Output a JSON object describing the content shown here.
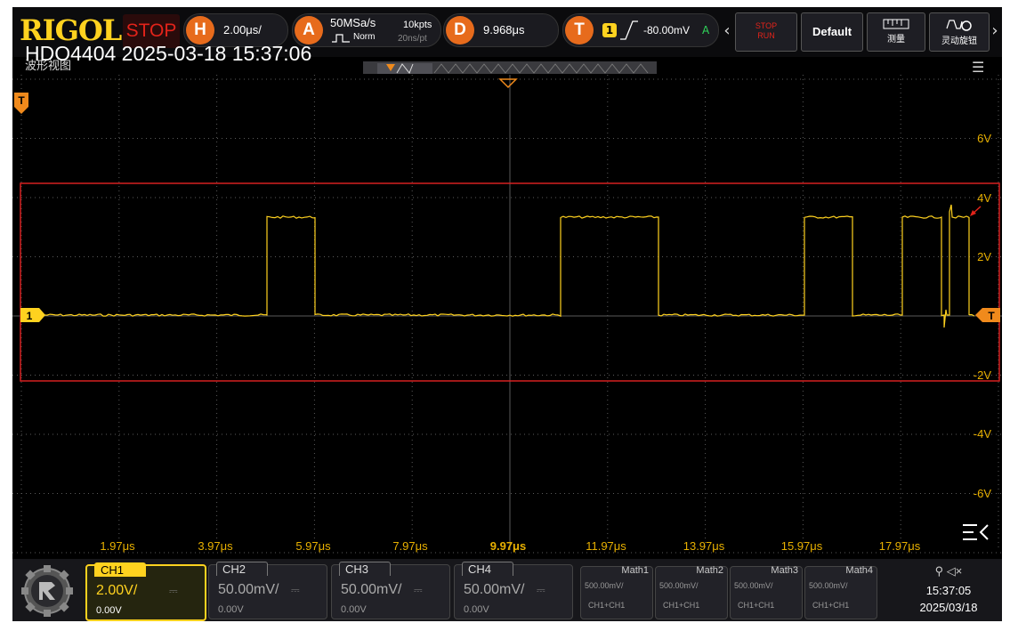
{
  "topbar": {
    "brand": "RIGOL",
    "run_state": "STOP",
    "horizontal": {
      "badge": "H",
      "scale": "2.00μs/"
    },
    "acquire": {
      "badge": "A",
      "sample_rate": "50MSa/s",
      "mode": "Norm",
      "memory": "10kpts",
      "interval": "20ns/pt"
    },
    "delay": {
      "badge": "D",
      "value": "9.968μs"
    },
    "trigger": {
      "badge": "T",
      "channel": "1",
      "level": "-80.00mV",
      "sweep": "A"
    },
    "buttons": {
      "stop_run_1": "STOP",
      "stop_run_2": "RUN",
      "default": "Default",
      "measure": "测量",
      "knob": "灵动旋钮"
    }
  },
  "title": {
    "device": "HDO4404 2025-03-18 15:37:06",
    "view": "波形视图"
  },
  "grid": {
    "channel_marker": "1",
    "trigger_marker": "T",
    "time_labels": [
      "1.97μs",
      "3.97μs",
      "5.97μs",
      "7.97μs",
      "9.97μs",
      "11.97μs",
      "13.97μs",
      "15.97μs",
      "17.97μs"
    ],
    "volt_labels": [
      "6V",
      "4V",
      "2V",
      "-2V",
      "-4V",
      "-6V"
    ]
  },
  "channels": [
    {
      "name": "CH1",
      "scale": "2.00V/",
      "offset": "0.00V",
      "active": true
    },
    {
      "name": "CH2",
      "scale": "50.00mV/",
      "offset": "0.00V",
      "active": false
    },
    {
      "name": "CH3",
      "scale": "50.00mV/",
      "offset": "0.00V",
      "active": false
    },
    {
      "name": "CH4",
      "scale": "50.00mV/",
      "offset": "0.00V",
      "active": false
    }
  ],
  "math": [
    {
      "name": "Math1",
      "scale": "500.00mV/",
      "source": "CH1+CH1"
    },
    {
      "name": "Math2",
      "scale": "500.00mV/",
      "source": "CH1+CH1"
    },
    {
      "name": "Math3",
      "scale": "500.00mV/",
      "source": "CH1+CH1"
    },
    {
      "name": "Math4",
      "scale": "500.00mV/",
      "source": "CH1+CH1"
    }
  ],
  "status": {
    "time": "15:37:05",
    "date": "2025/03/18"
  },
  "colors": {
    "trace": "#ffd21f",
    "accent": "#e76b1c",
    "stop": "#e2231a",
    "window": "#e0201c"
  }
}
